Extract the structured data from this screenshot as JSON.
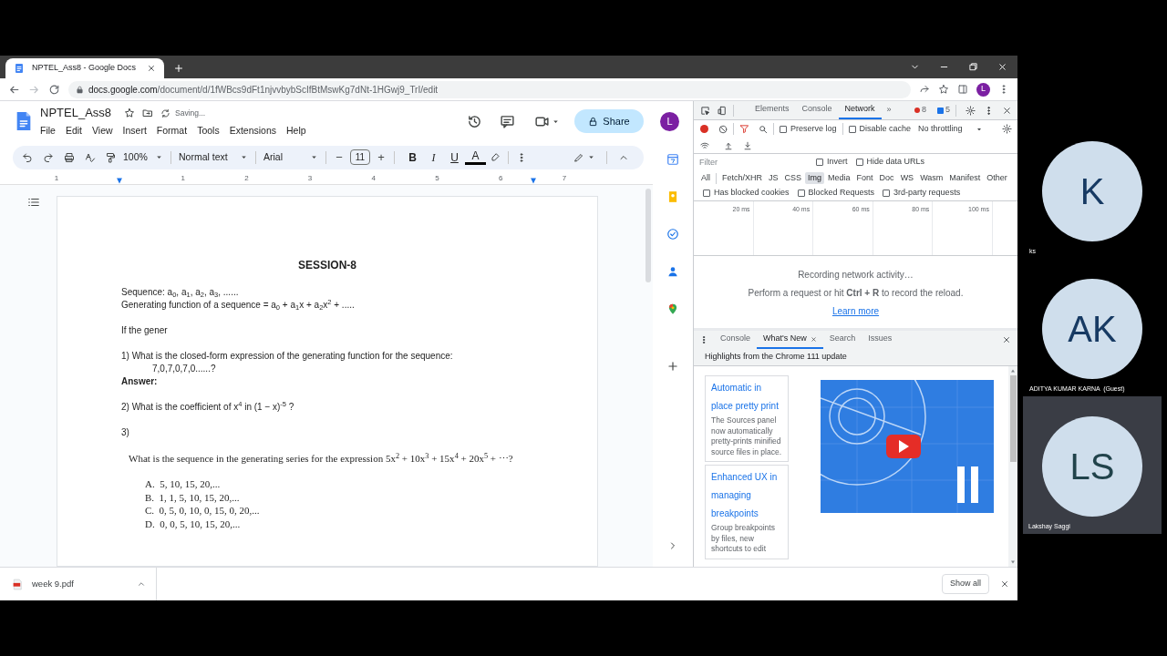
{
  "browser": {
    "tabs": [
      {
        "title": "NPTEL_Ass8 - Google Docs",
        "selected": true
      }
    ],
    "address": {
      "host": "docs.google.com",
      "path": "/document/d/1fWBcs9dFt1njvvbybScIfBtMswKg7dNt-1HGwj9_TrI/edit"
    },
    "profile_initial": "L"
  },
  "docs": {
    "title": "NPTEL_Ass8",
    "status": "Saving...",
    "menus": [
      "File",
      "Edit",
      "View",
      "Insert",
      "Format",
      "Tools",
      "Extensions",
      "Help"
    ],
    "share": "Share",
    "account_initial": "L",
    "toolbar": {
      "zoom": "100%",
      "style": "Normal text",
      "font": "Arial",
      "size_down": "−",
      "font_size": "11",
      "size_up": "+",
      "format": [
        {
          "label": "B",
          "kind": "bold"
        },
        {
          "label": "I",
          "kind": "italic"
        },
        {
          "label": "U",
          "kind": "underline"
        },
        {
          "label": "A",
          "kind": "color"
        }
      ]
    },
    "ruler": [
      "1",
      "1",
      "2",
      "3",
      "4",
      "5",
      "6",
      "7"
    ],
    "page": {
      "heading": "SESSION-8",
      "sections": [
        {
          "lines": [
            {
              "kind": "text",
              "text": "Sequence: a$_{0}$, a$_{1}$, a$_{2}$, a$_{3}$, ......"
            },
            {
              "kind": "text",
              "text": "Generating function of a sequence = a$_{0}$ + a$_{1}$x + a$_{2}$x$^{2}$ + ....."
            }
          ]
        },
        {
          "lines": [
            {
              "kind": "text",
              "text": "If the gener"
            }
          ]
        },
        {
          "lines": [
            {
              "kind": "text",
              "text": "1) What is the closed-form expression of the generating function for the sequence:"
            },
            {
              "kind": "indent",
              "text": "7,0,7,0,7,0......?"
            },
            {
              "kind": "bold",
              "text": "Answer:"
            }
          ]
        },
        {
          "lines": [
            {
              "kind": "text",
              "text": "2) What is the coefficient of x$^{4}$ in (1 − x)$^{-5}$ ?"
            }
          ]
        },
        {
          "lines": [
            {
              "kind": "text",
              "text": "3)"
            }
          ]
        },
        {
          "lines": [
            {
              "kind": "serif",
              "text": "What is the sequence in the generating series for the expression 5x$^{2}$ + 10x$^{3}$ + 15x$^{4}$ + 20x$^{5}$ + ⋯?"
            }
          ]
        },
        {
          "lines": [
            {
              "kind": "option",
              "text": "A.  5, 10, 15, 20,..."
            },
            {
              "kind": "option",
              "text": "B.  1, 1, 5, 10, 15, 20,..."
            },
            {
              "kind": "option",
              "text": "C.  0, 5, 0, 10, 0, 15, 0, 20,..."
            },
            {
              "kind": "option",
              "text": "D.  0, 0, 5, 10, 15, 20,..."
            }
          ]
        }
      ]
    }
  },
  "devtools": {
    "tabs": [
      {
        "label": "Elements",
        "selected": false
      },
      {
        "label": "Console",
        "selected": false
      },
      {
        "label": "Network",
        "selected": true
      }
    ],
    "more": "»",
    "errors": "8",
    "messages": "5",
    "preserve_log": {
      "label": "Preserve log",
      "checked": false
    },
    "disable_cache": {
      "label": "Disable cache",
      "checked": false
    },
    "throttling": "No throttling",
    "filter_placeholder": "Filter",
    "invert": {
      "label": "Invert",
      "checked": false
    },
    "hide_data_urls": {
      "label": "Hide data URLs",
      "checked": false
    },
    "type_filters": [
      {
        "label": "All",
        "selected": false
      },
      {
        "label": "Fetch/XHR",
        "selected": false
      },
      {
        "label": "JS",
        "selected": false
      },
      {
        "label": "CSS",
        "selected": false
      },
      {
        "label": "Img",
        "selected": true
      },
      {
        "label": "Media",
        "selected": false
      },
      {
        "label": "Font",
        "selected": false
      },
      {
        "label": "Doc",
        "selected": false
      },
      {
        "label": "WS",
        "selected": false
      },
      {
        "label": "Wasm",
        "selected": false
      },
      {
        "label": "Manifest",
        "selected": false
      },
      {
        "label": "Other",
        "selected": false
      }
    ],
    "request_filters": [
      {
        "label": "Has blocked cookies",
        "checked": false
      },
      {
        "label": "Blocked Requests",
        "checked": false
      },
      {
        "label": "3rd-party requests",
        "checked": false
      }
    ],
    "timeline_ticks": [
      "20 ms",
      "40 ms",
      "60 ms",
      "80 ms",
      "100 ms"
    ],
    "empty_title": "Recording network activity…",
    "empty_hint": "Perform a request or hit **Ctrl + R** to record the reload.",
    "learn_more": "Learn more",
    "drawer": {
      "tabs": [
        {
          "label": "Console",
          "selected": false,
          "closable": false
        },
        {
          "label": "What's New",
          "selected": true,
          "closable": true
        },
        {
          "label": "Search",
          "selected": false,
          "closable": false
        },
        {
          "label": "Issues",
          "selected": false,
          "closable": false
        }
      ],
      "headline": "Highlights from the Chrome 111 update",
      "cards": [
        {
          "title": "Automatic in place pretty print",
          "text": "The Sources panel now automatically pretty-prints minified source files in place."
        },
        {
          "title": "Enhanced UX in managing breakpoints",
          "text": "Group breakpoints by files, new shortcuts to edit"
        }
      ]
    }
  },
  "downloads": {
    "file": "week 9.pdf",
    "show_all": "Show all"
  },
  "participants": [
    {
      "initials": "K",
      "name": "ks",
      "highlighted": false
    },
    {
      "initials": "AK",
      "name": "ADITYA KUMAR KARNA  (Guest)",
      "highlighted": false
    },
    {
      "initials": "LS",
      "name": "Lakshay Saggi",
      "highlighted": true
    }
  ]
}
